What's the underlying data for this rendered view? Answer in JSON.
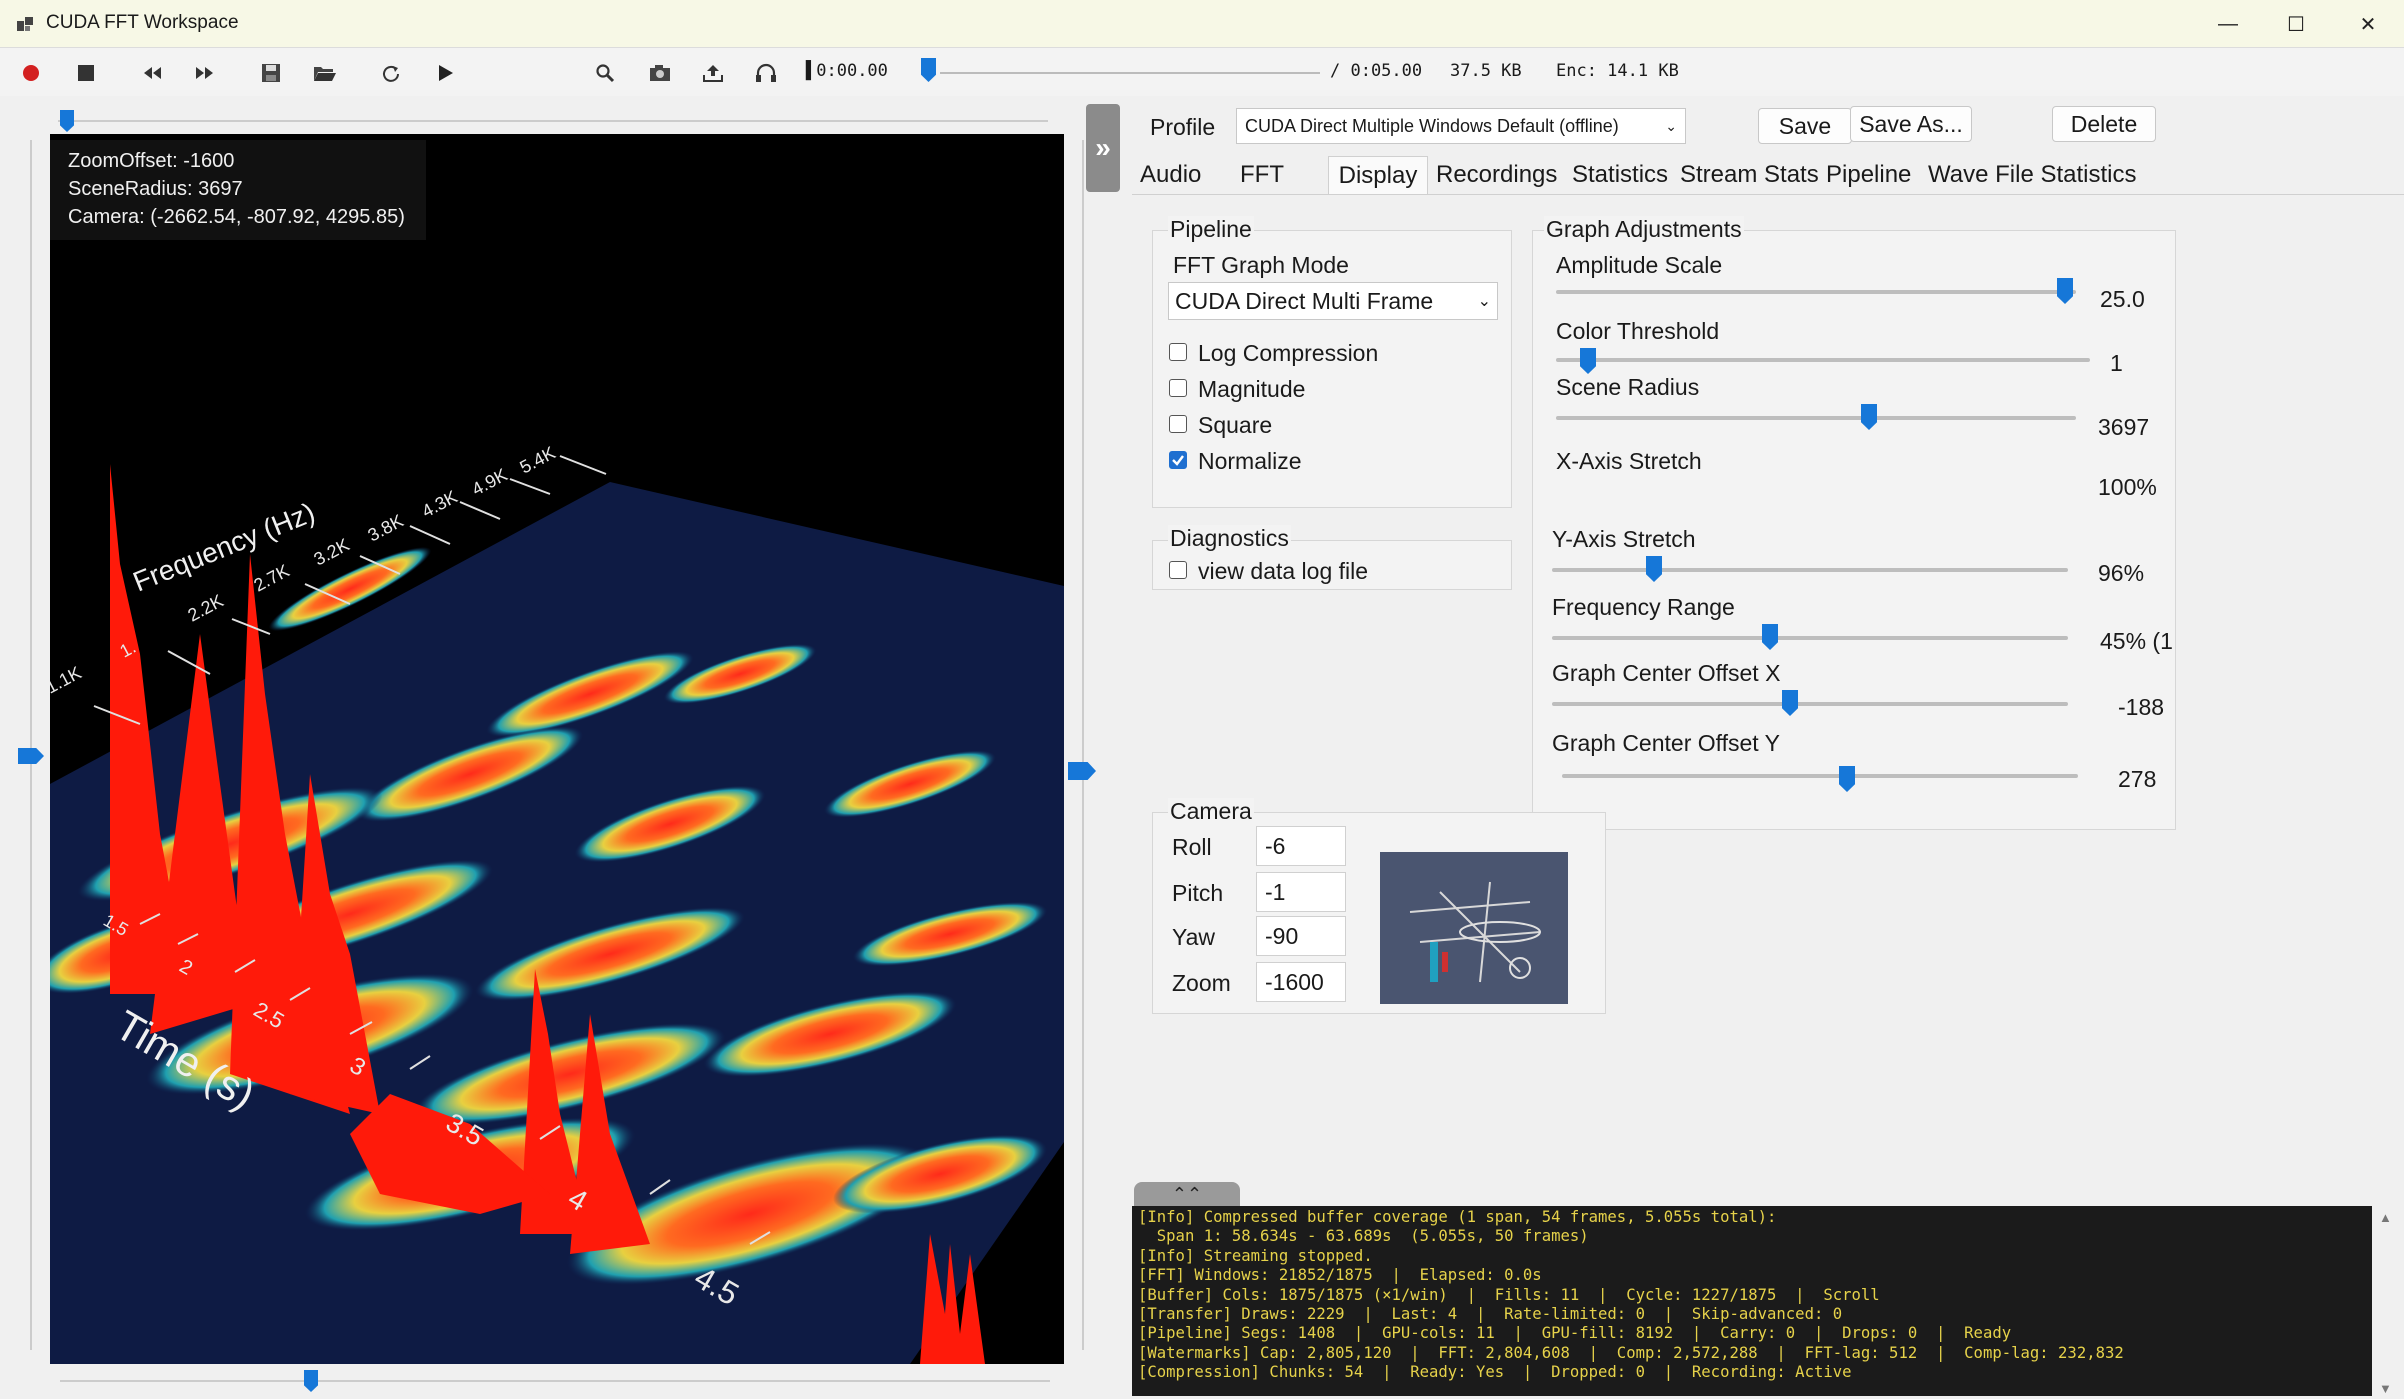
{
  "window": {
    "title": "CUDA FFT Workspace"
  },
  "toolbar": {
    "time_current": "0:00.00",
    "time_total": "/ 0:05.00",
    "size": "37.5 KB",
    "encoded": "Enc: 14.1 KB",
    "playback_position": 0.0
  },
  "overlay": {
    "zoom_offset": "ZoomOffset: -1600",
    "scene_radius": "SceneRadius: 3697",
    "camera": "Camera: (-2662.54, -807.92, 4295.85)"
  },
  "plot": {
    "freq_axis_label": "Frequency (Hz)",
    "time_axis_label": "Time (s)",
    "freq_ticks": [
      "1.1K",
      "1.",
      "2.2K",
      "2.7K",
      "3.2K",
      "3.8K",
      "4.3K",
      "4.9K",
      "5.4K"
    ],
    "time_ticks": [
      "1.5",
      "2",
      "2.5",
      "3",
      "3.5",
      "4",
      "4.5"
    ]
  },
  "profile": {
    "label": "Profile",
    "selected": "CUDA Direct Multiple Windows Default (offline)",
    "save": "Save",
    "save_as": "Save As...",
    "delete": "Delete"
  },
  "tabs": [
    {
      "label": "Audio"
    },
    {
      "label": "FFT"
    },
    {
      "label": "Display"
    },
    {
      "label": "Recordings"
    },
    {
      "label": "Statistics"
    },
    {
      "label": "Stream Stats"
    },
    {
      "label": "Pipeline"
    },
    {
      "label": "Wave File Statistics"
    }
  ],
  "active_tab": "Display",
  "pipeline": {
    "title": "Pipeline",
    "mode_label": "FFT Graph Mode",
    "mode_value": "CUDA Direct Multi Frame",
    "checks": [
      {
        "label": "Log Compression",
        "checked": false
      },
      {
        "label": "Magnitude",
        "checked": false
      },
      {
        "label": "Square",
        "checked": false
      },
      {
        "label": "Normalize",
        "checked": true
      }
    ]
  },
  "diagnostics": {
    "title": "Diagnostics",
    "check": {
      "label": "view data log file",
      "checked": false
    }
  },
  "graph": {
    "title": "Graph Adjustments",
    "sliders": [
      {
        "label": "Amplitude Scale",
        "value": "25.0"
      },
      {
        "label": "Color Threshold",
        "value": "1"
      },
      {
        "label": "Scene Radius",
        "value": "3697"
      },
      {
        "label": "X-Axis Stretch",
        "value": "100%"
      },
      {
        "label": "Y-Axis Stretch",
        "value": "96%"
      },
      {
        "label": "Frequency Range",
        "value": "45% (1"
      },
      {
        "label": "Graph Center Offset X",
        "value": "-188"
      },
      {
        "label": "Graph Center Offset Y",
        "value": "278"
      }
    ]
  },
  "camera": {
    "title": "Camera",
    "fields": [
      {
        "label": "Roll",
        "value": "-6"
      },
      {
        "label": "Pitch",
        "value": "-1"
      },
      {
        "label": "Yaw",
        "value": "-90"
      },
      {
        "label": "Zoom",
        "value": "-1600"
      }
    ]
  },
  "log": {
    "lines": [
      "[Info] Compressed buffer coverage (1 span, 54 frames, 5.055s total):",
      "  Span 1: 58.634s - 63.689s  (5.055s, 50 frames)",
      "[Info] Streaming stopped.",
      "[FFT] Windows: 21852/1875  |  Elapsed: 0.0s",
      "[Buffer] Cols: 1875/1875 (×1/win)  |  Fills: 11  |  Cycle: 1227/1875  |  Scroll",
      "[Transfer] Draws: 2229  |  Last: 4  |  Rate-limited: 0  |  Skip-advanced: 0",
      "[Pipeline] Segs: 1408  |  GPU-cols: 11  |  GPU-fill: 8192  |  Carry: 0  |  Drops: 0  |  Ready",
      "[Watermarks] Cap: 2,805,120  |  FFT: 2,804,608  |  Comp: 2,572,288  |  FFT-lag: 512  |  Comp-lag: 232,832",
      "[Compression] Chunks: 54  |  Ready: Yes  |  Dropped: 0  |  Recording: Active"
    ]
  }
}
